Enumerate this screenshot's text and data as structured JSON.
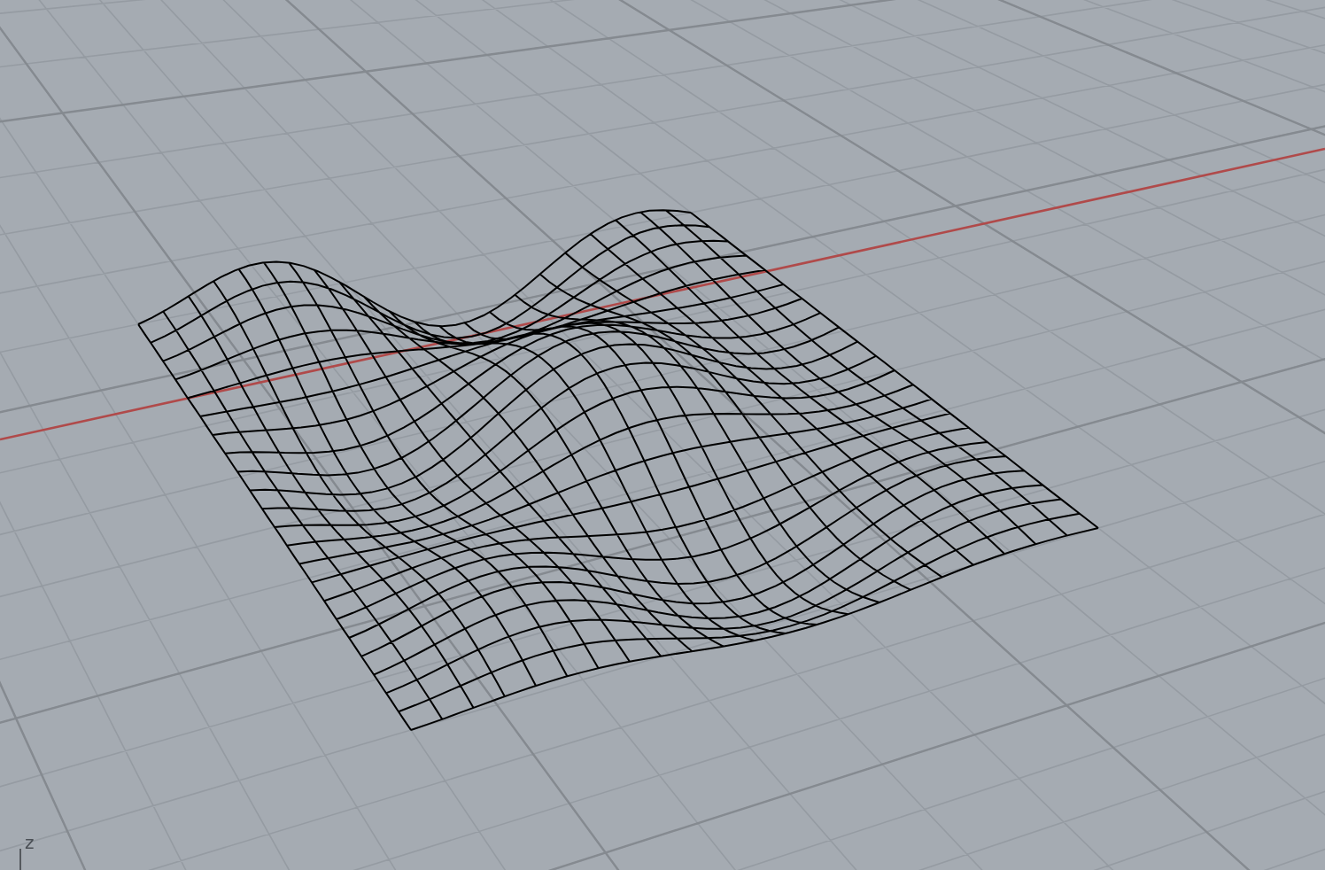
{
  "viewport": {
    "axis_label": "z"
  }
}
